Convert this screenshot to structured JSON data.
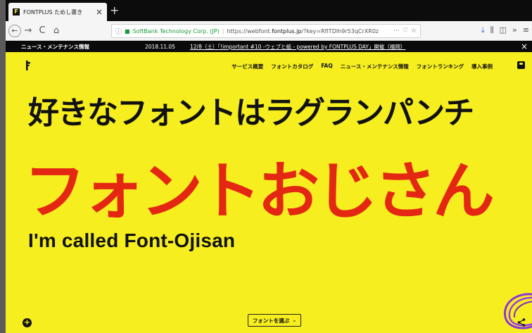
{
  "browser": {
    "tab_title": "FONTPLUS ためし書き",
    "tab_close": "×",
    "new_tab": "+",
    "nav": {
      "back": "←",
      "forward": "→",
      "reload": "C",
      "home": "⌂"
    },
    "url": {
      "info_icon": "ⓘ",
      "lock_icon": "🔒",
      "organization": "SoftBank Technology Corp. (JP)",
      "prefix": "https://webfont.",
      "domain": "fontplus.jp",
      "suffix": "/?key=RfITDIh9r53qCrXR0z",
      "more": "···"
    },
    "toolbar_icons": [
      "download-icon",
      "library-icon",
      "sidebar-icon",
      "overflow-icon",
      "menu-icon"
    ],
    "toolbar_glyphs": {
      "pocket": "♡",
      "star": "☆",
      "download": "⤓",
      "library": "⫼",
      "sidebar": "◫",
      "overflow": "»",
      "menu": "≡"
    }
  },
  "newsbar": {
    "label": "ニュース・メンテナンス情報",
    "date": "2018.11.05",
    "headline": "12/8（土）「!important #10 -ウェブと紙 - powered by FONTPLUS DAY」開催（福岡）",
    "close": "×"
  },
  "site": {
    "logo_icon": "fontplus-logo-icon",
    "nav": [
      "サービス概要",
      "フォントカタログ",
      "FAQ",
      "ニュース・メンテナンス情報",
      "フォントランキング",
      "導入事例"
    ],
    "user_icon": "user-icon",
    "accent_yellow": "#f6ee1f",
    "accent_red": "#e42713"
  },
  "hero": {
    "tagline": "好きなフォントはラグランパンチ",
    "name_ja": "フォントおじさん",
    "name_en": "I'm called Font-Ojisan"
  },
  "controls": {
    "plus": "+",
    "choose_font": "フォントを選ぶ",
    "choose_chevron": "⌄"
  }
}
